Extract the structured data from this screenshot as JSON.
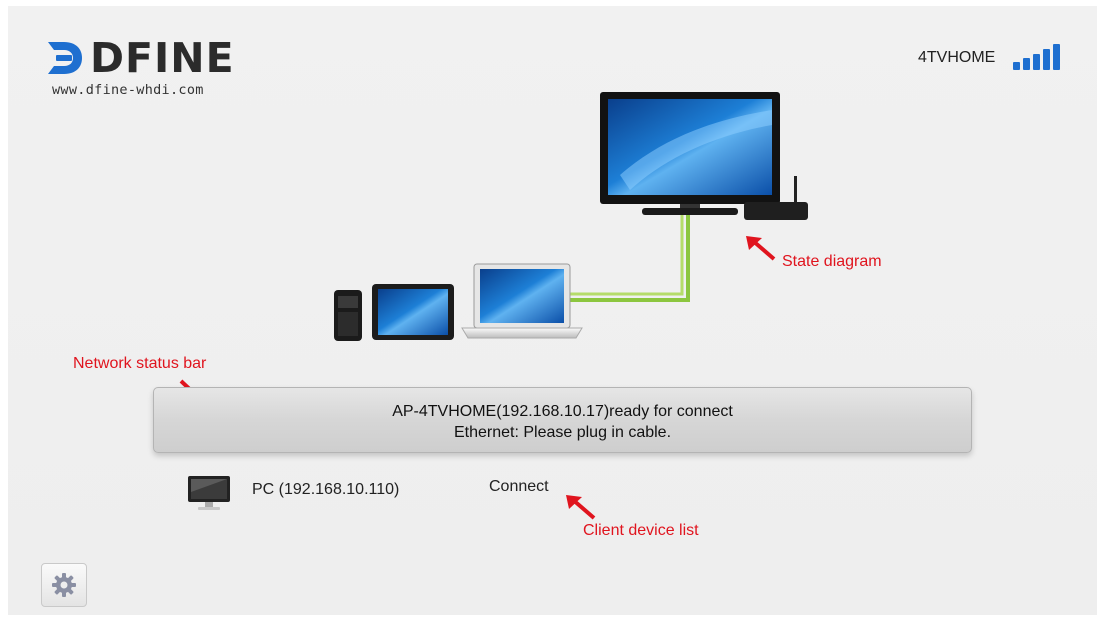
{
  "brand": {
    "logo_text": "DFINE",
    "url": "www.dfine-whdi.com"
  },
  "network": {
    "name": "4TVHOME",
    "signal_bars": 5,
    "signal_level": 5
  },
  "annotations": {
    "state_diagram": "State diagram",
    "network_status_bar": "Network status bar",
    "client_device_list": "Client device list"
  },
  "status_bar": {
    "line1": "AP-4TVHOME(192.168.10.17)ready for connect",
    "line2": "Ethernet: Please plug in cable."
  },
  "clients": [
    {
      "name": "PC  (192.168.10.110)",
      "action": "Connect",
      "icon": "monitor-icon"
    }
  ],
  "settings": {
    "icon": "gear-icon"
  },
  "colors": {
    "accent_blue": "#1e6fd0",
    "annotation_red": "#e0141e",
    "cable_green": "#8cc63f"
  }
}
